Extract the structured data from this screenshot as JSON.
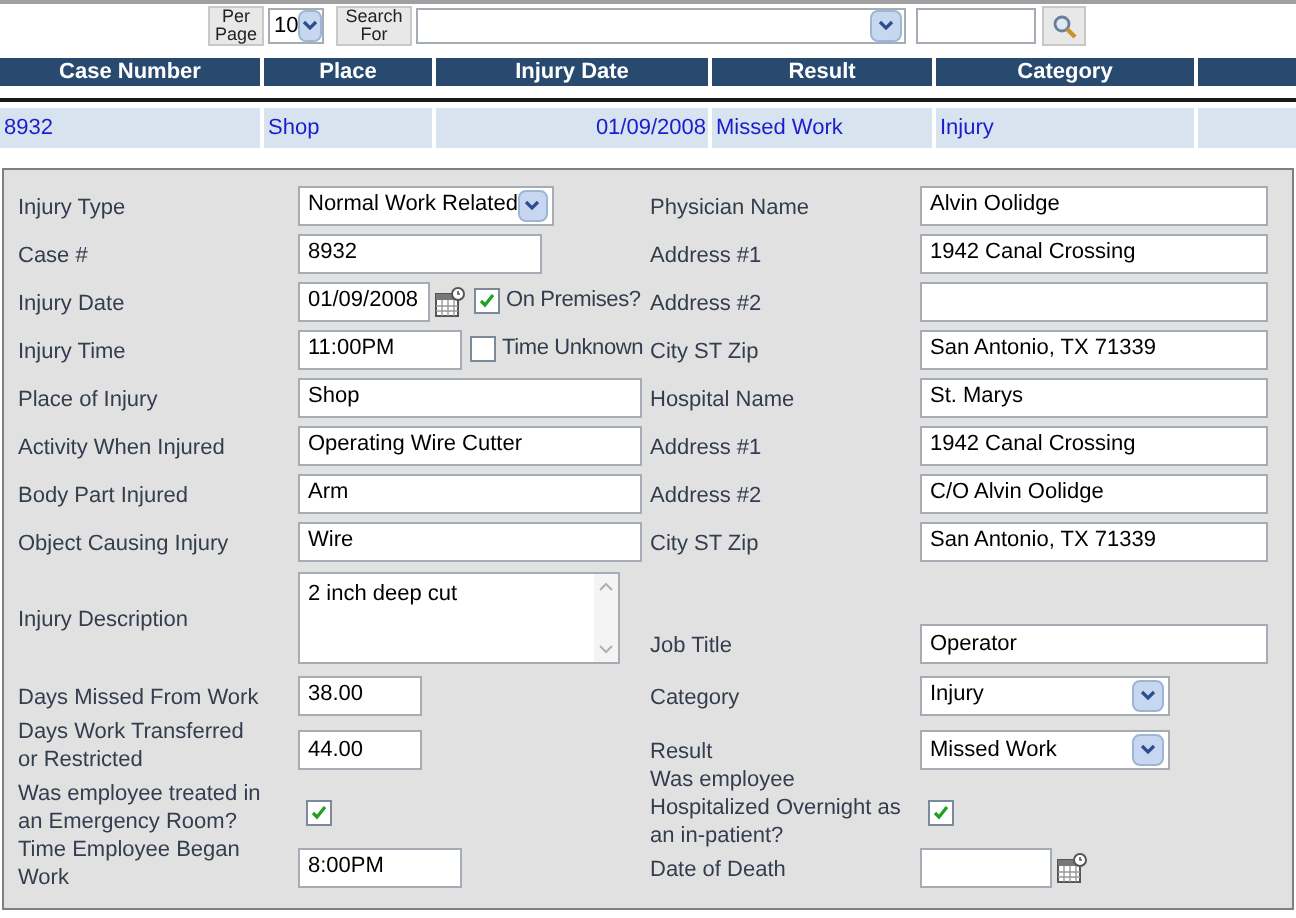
{
  "toolbar": {
    "per_page_label": "Per Page",
    "per_page_value": "10",
    "search_label": "Search For"
  },
  "table": {
    "columns": [
      "Case Number",
      "Place",
      "Injury Date",
      "Result",
      "Category"
    ],
    "rows": [
      {
        "cells": [
          "8932",
          "Shop",
          "01/09/2008",
          "Missed Work",
          "Injury"
        ]
      }
    ]
  },
  "form": {
    "rows": [
      {
        "left": {
          "label": "Injury Type",
          "kind": "select",
          "value": "Normal Work Related"
        },
        "right": {
          "label": "Physician Name",
          "kind": "text",
          "value": "Alvin Oolidge"
        }
      },
      {
        "left": {
          "label": "Case #",
          "kind": "medium-text",
          "value": "8932"
        },
        "right": {
          "label": "Address #1",
          "kind": "text",
          "value": "1942 Canal Crossing"
        }
      },
      {
        "left": {
          "label": "Injury Date",
          "kind": "date",
          "value": "01/09/2008",
          "check": {
            "label": "On Premises?",
            "checked": true
          }
        },
        "right": {
          "label": "Address #2",
          "kind": "text"
        }
      },
      {
        "left": {
          "label": "Injury Time",
          "kind": "time",
          "value": "11:00PM",
          "check": {
            "label": "Time Unknown",
            "checked": false
          }
        },
        "right": {
          "label": "City ST Zip",
          "kind": "text",
          "value": "San Antonio, TX 71339"
        }
      },
      {
        "left": {
          "label": "Place of Injury",
          "kind": "text",
          "value": "Shop"
        },
        "right": {
          "label": "Hospital Name",
          "kind": "text",
          "value": "St. Marys"
        }
      },
      {
        "left": {
          "label": "Activity When Injured",
          "kind": "text",
          "value": "Operating Wire Cutter"
        },
        "right": {
          "label": "Address #1",
          "kind": "text",
          "value": "1942 Canal Crossing"
        }
      },
      {
        "left": {
          "label": "Body Part Injured",
          "kind": "text",
          "value": "Arm"
        },
        "right": {
          "label": "Address #2",
          "kind": "text",
          "value": "C/O Alvin Oolidge"
        }
      },
      {
        "left": {
          "label": "Object Causing Injury",
          "kind": "text",
          "value": "Wire"
        },
        "right": {
          "label": "City ST Zip",
          "kind": "text",
          "value": "San Antonio, TX 71339"
        }
      },
      {
        "left": {
          "label": "Injury Description",
          "kind": "textarea",
          "value": "2 inch deep cut"
        },
        "right": {
          "label": "Job Title",
          "kind": "text",
          "value": "Operator"
        }
      },
      {
        "left": {
          "label": "Days Missed From Work",
          "kind": "short-text",
          "value": "38.00"
        },
        "right": {
          "label": "Category",
          "kind": "select",
          "value": "Injury"
        }
      },
      {
        "left": {
          "label": "Days Work Transferred or Restricted",
          "kind": "short-text",
          "value": "44.00"
        },
        "right": {
          "label": "Result",
          "kind": "select",
          "value": "Missed Work"
        }
      },
      {
        "left": {
          "label": "Was employee treated in an Emergency Room?",
          "kind": "checkbox",
          "checked": true
        },
        "right": {
          "label": "Was employee Hospitalized Overnight as an in-patient?",
          "kind": "checkbox",
          "checked": true
        }
      },
      {
        "left": {
          "label": "Time Employee Began Work",
          "kind": "time",
          "value": "8:00PM"
        },
        "right": {
          "label": "Date of Death",
          "kind": "date"
        }
      }
    ]
  }
}
